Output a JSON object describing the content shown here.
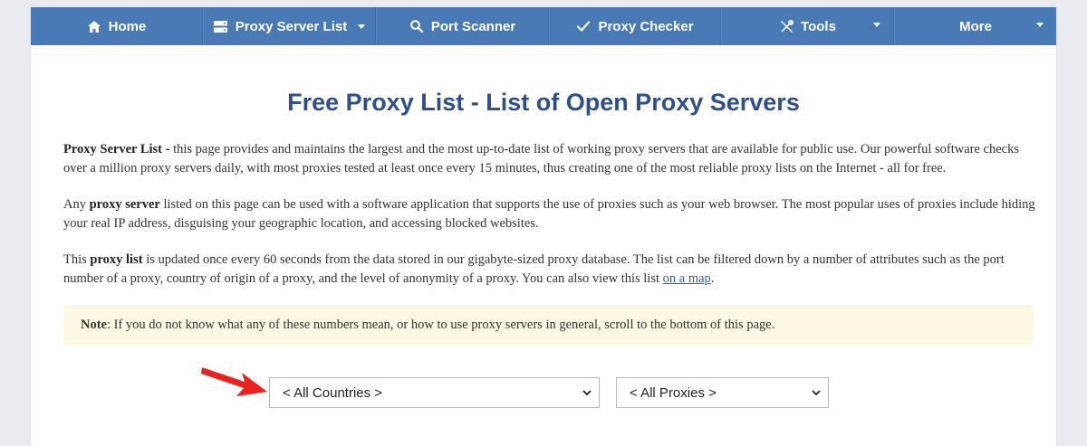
{
  "nav": {
    "home": "Home",
    "proxy_server_list": "Proxy Server List",
    "port_scanner": "Port Scanner",
    "proxy_checker": "Proxy Checker",
    "tools": "Tools",
    "more": "More"
  },
  "page_title": "Free Proxy List - List of Open Proxy Servers",
  "paragraphs": {
    "p1_bold": "Proxy Server List -",
    "p1_text": " this page provides and maintains the largest and the most up-to-date list of working proxy servers that are available for public use. Our powerful software checks over a million proxy servers daily, with most proxies tested at least once every 15 minutes, thus creating one of the most reliable proxy lists on the Internet - all for free.",
    "p2_pre": "Any ",
    "p2_bold": "proxy server",
    "p2_text": " listed on this page can be used with a software application that supports the use of proxies such as your web browser. The most popular uses of proxies include hiding your real IP address, disguising your geographic location, and accessing blocked websites.",
    "p3_pre": "This ",
    "p3_bold": "proxy list",
    "p3_text": " is updated once every 60 seconds from the data stored in our gigabyte-sized proxy database. The list can be filtered down by a number of attributes such as the port number of a proxy, country of origin of a proxy, and the level of anonymity of a proxy. You can also view this list ",
    "p3_link": "on a map",
    "p3_end": "."
  },
  "note": {
    "label": "Note",
    "text": ": If you do not know what any of these numbers mean, or how to use proxy servers in general, scroll to the bottom of this page."
  },
  "filters": {
    "country_selected": "< All Countries >",
    "proxy_selected": "< All Proxies >"
  },
  "colors": {
    "nav_bg": "#4a7ab5",
    "title": "#2e4f8a",
    "note_bg": "#fcf8e3",
    "arrow": "#e8231d",
    "link": "#2a5db0"
  }
}
